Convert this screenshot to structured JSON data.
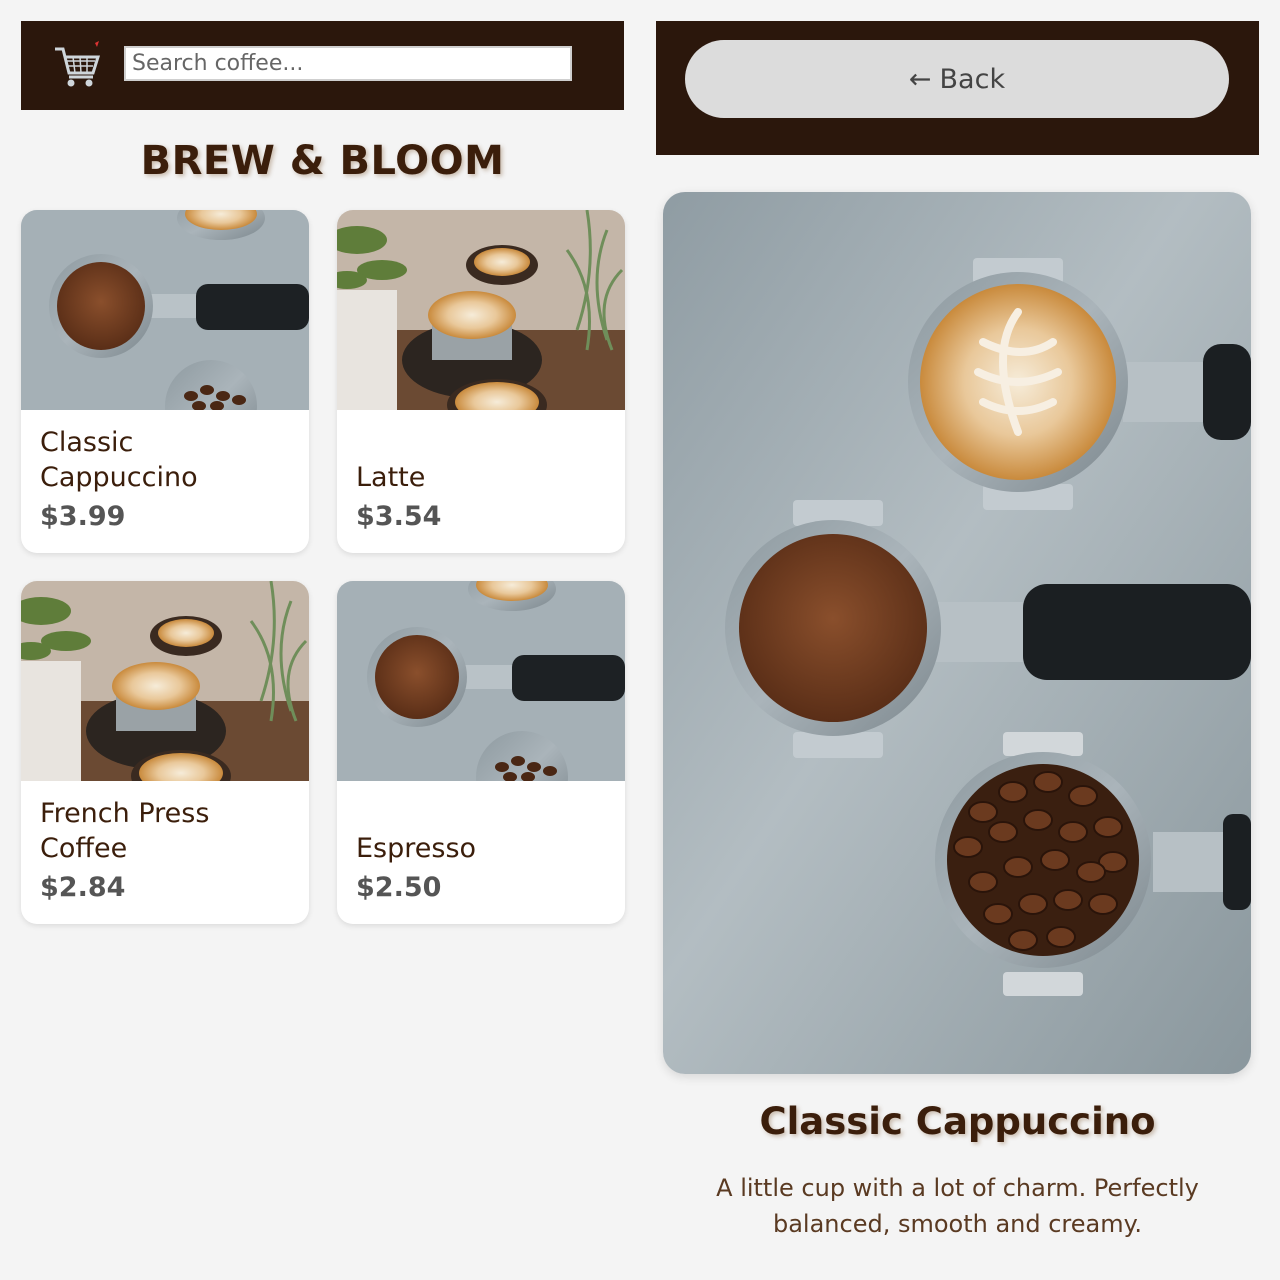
{
  "header": {
    "cart_icon": "shopping-cart-icon",
    "search_placeholder": "Search coffee...",
    "search_value": ""
  },
  "brand": "BREW & BLOOM",
  "products": [
    {
      "name": "Classic Cappuccino",
      "price": "$3.99",
      "image": "portafilters-photo"
    },
    {
      "name": "Latte",
      "price": "$3.54",
      "image": "latte-table-photo"
    },
    {
      "name": "French Press Coffee",
      "price": "$2.84",
      "image": "latte-table-photo"
    },
    {
      "name": "Espresso",
      "price": "$2.50",
      "image": "portafilters-photo"
    }
  ],
  "detail": {
    "back_label": "Back",
    "back_icon": "arrow-left-icon",
    "title": "Classic Cappuccino",
    "description": "A little cup with a lot of charm. Perfectly balanced, smooth and creamy.",
    "image": "portafilters-photo"
  },
  "colors": {
    "header_bg": "#2b170c",
    "brand_text": "#3b1e0b",
    "page_bg": "#f4f4f4",
    "button_bg": "#dcdcdc"
  }
}
